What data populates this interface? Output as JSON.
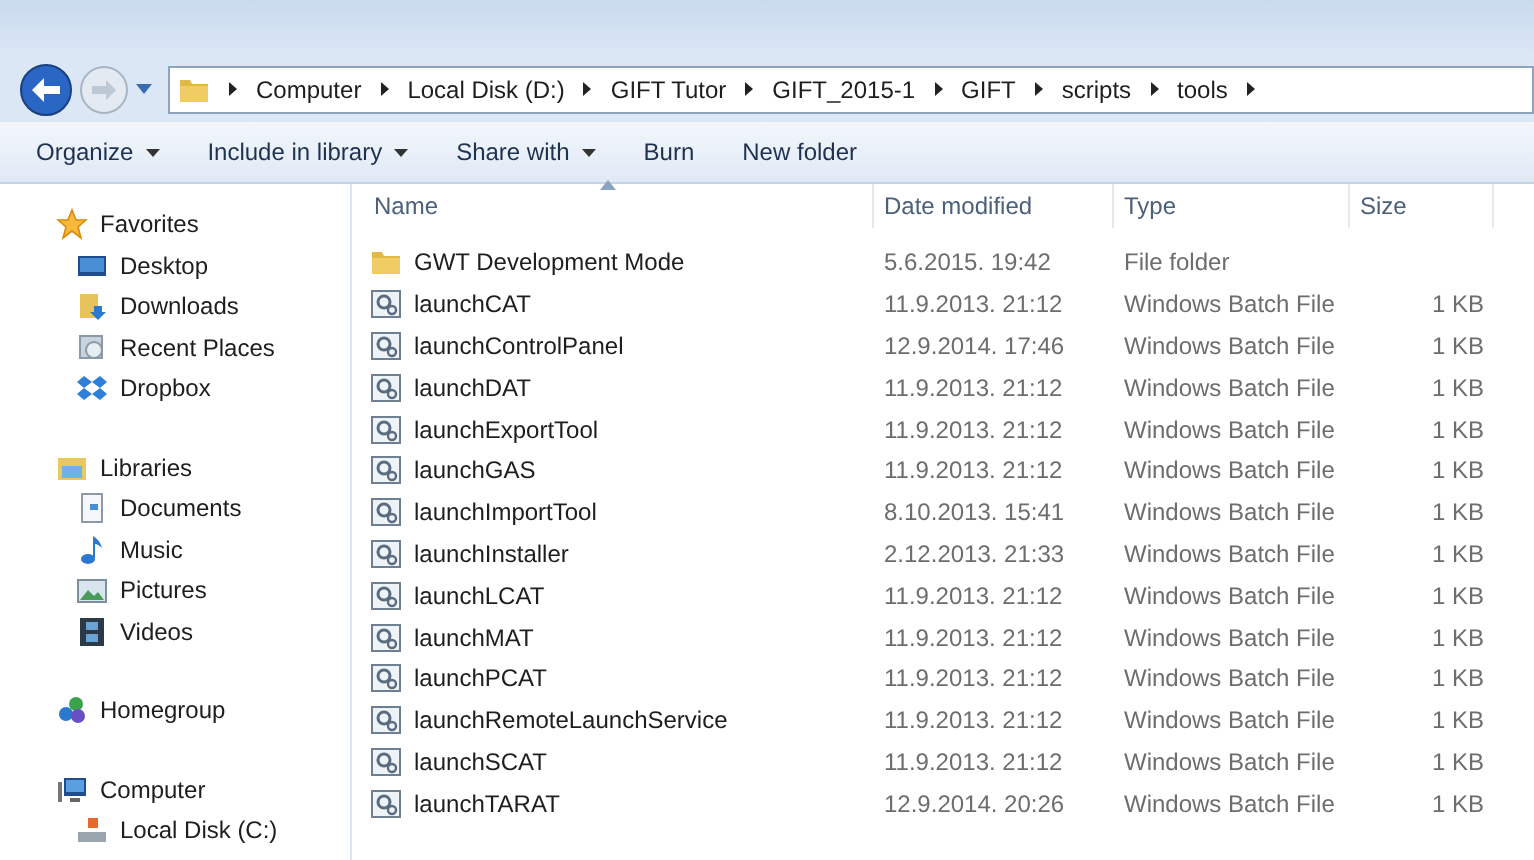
{
  "breadcrumb": [
    "Computer",
    "Local Disk (D:)",
    "GIFT Tutor",
    "GIFT_2015-1",
    "GIFT",
    "scripts",
    "tools"
  ],
  "toolbar": [
    {
      "label": "Organize",
      "dropdown": true
    },
    {
      "label": "Include in library",
      "dropdown": true
    },
    {
      "label": "Share with",
      "dropdown": true
    },
    {
      "label": "Burn",
      "dropdown": false
    },
    {
      "label": "New folder",
      "dropdown": false
    }
  ],
  "sidebar": [
    {
      "label": "Favorites",
      "kind": "star",
      "children": [
        {
          "label": "Desktop",
          "kind": "desktop"
        },
        {
          "label": "Downloads",
          "kind": "downloads"
        },
        {
          "label": "Recent Places",
          "kind": "recent"
        },
        {
          "label": "Dropbox",
          "kind": "dropbox"
        }
      ]
    },
    {
      "label": "Libraries",
      "kind": "library",
      "children": [
        {
          "label": "Documents",
          "kind": "documents"
        },
        {
          "label": "Music",
          "kind": "music"
        },
        {
          "label": "Pictures",
          "kind": "pictures"
        },
        {
          "label": "Videos",
          "kind": "videos"
        }
      ]
    },
    {
      "label": "Homegroup",
      "kind": "homegroup"
    },
    {
      "label": "Computer",
      "kind": "computer",
      "children": [
        {
          "label": "Local Disk (C:)",
          "kind": "disk"
        }
      ]
    }
  ],
  "columns": [
    {
      "label": "Name",
      "sorted": true
    },
    {
      "label": "Date modified",
      "sorted": false
    },
    {
      "label": "Type",
      "sorted": false
    },
    {
      "label": "Size",
      "sorted": false
    }
  ],
  "files": [
    {
      "name": "GWT Development Mode",
      "date": "5.6.2015. 19:42",
      "type": "File folder",
      "kind": "folder"
    },
    {
      "name": "launchCAT",
      "date": "11.9.2013. 21:12",
      "type": "Windows Batch File",
      "size": "1 KB",
      "kind": "batch"
    },
    {
      "name": "launchControlPanel",
      "date": "12.9.2014. 17:46",
      "type": "Windows Batch File",
      "size": "1 KB",
      "kind": "batch"
    },
    {
      "name": "launchDAT",
      "date": "11.9.2013. 21:12",
      "type": "Windows Batch File",
      "size": "1 KB",
      "kind": "batch"
    },
    {
      "name": "launchExportTool",
      "date": "11.9.2013. 21:12",
      "type": "Windows Batch File",
      "size": "1 KB",
      "kind": "batch"
    },
    {
      "name": "launchGAS",
      "date": "11.9.2013. 21:12",
      "type": "Windows Batch File",
      "size": "1 KB",
      "kind": "batch"
    },
    {
      "name": "launchImportTool",
      "date": "8.10.2013. 15:41",
      "type": "Windows Batch File",
      "size": "1 KB",
      "kind": "batch"
    },
    {
      "name": "launchInstaller",
      "date": "2.12.2013. 21:33",
      "type": "Windows Batch File",
      "size": "1 KB",
      "kind": "batch"
    },
    {
      "name": "launchLCAT",
      "date": "11.9.2013. 21:12",
      "type": "Windows Batch File",
      "size": "1 KB",
      "kind": "batch"
    },
    {
      "name": "launchMAT",
      "date": "11.9.2013. 21:12",
      "type": "Windows Batch File",
      "size": "1 KB",
      "kind": "batch"
    },
    {
      "name": "launchPCAT",
      "date": "11.9.2013. 21:12",
      "type": "Windows Batch File",
      "size": "1 KB",
      "kind": "batch"
    },
    {
      "name": "launchRemoteLaunchService",
      "date": "11.9.2013. 21:12",
      "type": "Windows Batch File",
      "size": "1 KB",
      "kind": "batch"
    },
    {
      "name": "launchSCAT",
      "date": "11.9.2013. 21:12",
      "type": "Windows Batch File",
      "size": "1 KB",
      "kind": "batch"
    },
    {
      "name": "launchTARAT",
      "date": "12.9.2014. 20:26",
      "type": "Windows Batch File",
      "size": "1 KB",
      "kind": "batch"
    }
  ]
}
